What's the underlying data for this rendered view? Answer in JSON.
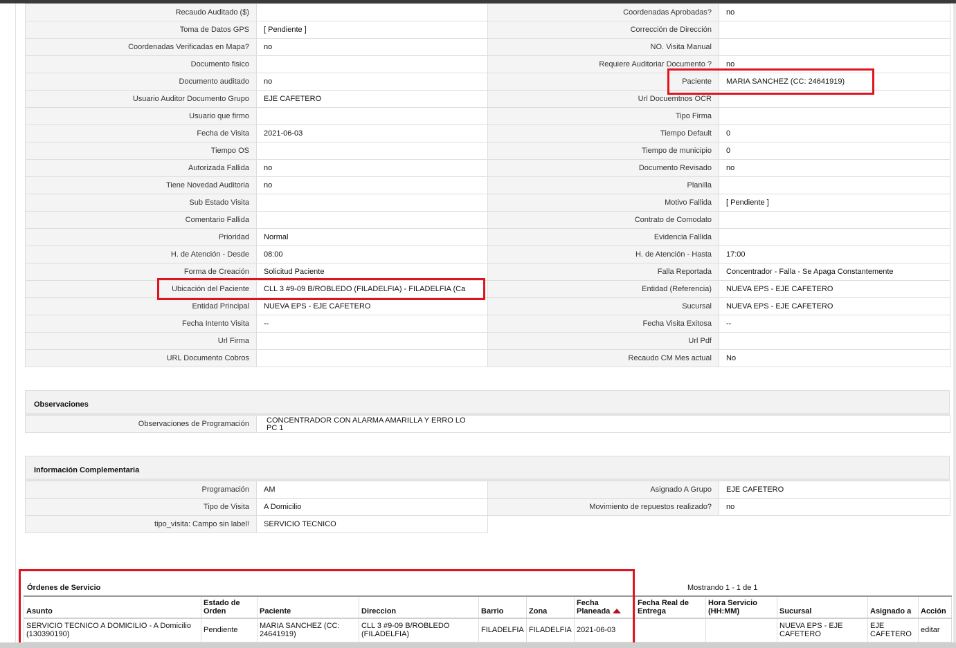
{
  "details": [
    {
      "l1": "Recaudo Auditado ($)",
      "v1": "",
      "l2": "Coordenadas Aprobadas?",
      "v2": "no"
    },
    {
      "l1": "Toma de Datos GPS",
      "v1": "[ Pendiente ]",
      "l2": "Corrección de Dirección",
      "v2": ""
    },
    {
      "l1": "Coordenadas Verificadas en Mapa?",
      "v1": "no",
      "l2": "NO. Visita Manual",
      "v2": ""
    },
    {
      "l1": "Documento fisico",
      "v1": "",
      "l2": "Requiere Auditoriar Documento ?",
      "v2": "no"
    },
    {
      "l1": "Documento auditado",
      "v1": "no",
      "l2": "Paciente",
      "v2": "MARIA SANCHEZ (CC: 24641919)"
    },
    {
      "l1": "Usuario Auditor Documento Grupo",
      "v1": "EJE CAFETERO",
      "l2": "Url Docuemtnos OCR",
      "v2": ""
    },
    {
      "l1": "Usuario que firmo",
      "v1": "",
      "l2": "Tipo Firma",
      "v2": ""
    },
    {
      "l1": "Fecha de Visita",
      "v1": "2021-06-03",
      "l2": "Tiempo Default",
      "v2": "0"
    },
    {
      "l1": "Tiempo OS",
      "v1": "",
      "l2": "Tiempo de municipio",
      "v2": "0"
    },
    {
      "l1": "Autorizada Fallida",
      "v1": "no",
      "l2": "Documento Revisado",
      "v2": "no"
    },
    {
      "l1": "Tiene Novedad Auditoria",
      "v1": "no",
      "l2": "Planilla",
      "v2": ""
    },
    {
      "l1": "Sub Estado Visita",
      "v1": "",
      "l2": "Motivo Fallida",
      "v2": "[ Pendiente ]"
    },
    {
      "l1": "Comentario Fallida",
      "v1": "",
      "l2": "Contrato de Comodato",
      "v2": ""
    },
    {
      "l1": "Prioridad",
      "v1": "Normal",
      "l2": "Evidencia Fallida",
      "v2": ""
    },
    {
      "l1": "H. de Atención - Desde",
      "v1": "08:00",
      "l2": "H. de Atención - Hasta",
      "v2": "17:00"
    },
    {
      "l1": "Forma de Creación",
      "v1": "Solicitud Paciente",
      "l2": "Falla Reportada",
      "v2": "Concentrador - Falla - Se Apaga Constantemente"
    },
    {
      "l1": "Ubicación del Paciente",
      "v1": "CLL 3 #9-09 B/ROBLEDO (FILADELFIA) - FILADELFIA (Ca",
      "l2": "Entidad (Referencia)",
      "v2": "NUEVA EPS - EJE CAFETERO"
    },
    {
      "l1": "Entidad Principal",
      "v1": "NUEVA EPS - EJE CAFETERO",
      "l2": "Sucursal",
      "v2": "NUEVA EPS - EJE CAFETERO"
    },
    {
      "l1": "Fecha Intento Visita",
      "v1": "--",
      "l2": "Fecha Visita Exitosa",
      "v2": "--"
    },
    {
      "l1": "Url Firma",
      "v1": "",
      "l2": "Url Pdf",
      "v2": ""
    },
    {
      "l1": "URL Documento Cobros",
      "v1": "",
      "l2": "Recaudo CM Mes actual",
      "v2": "No"
    }
  ],
  "observaciones": {
    "title": "Observaciones",
    "label": "Observaciones de Programación",
    "value": " CONCENTRADOR CON ALARMA AMARILLA Y ERRO LO PC 1"
  },
  "complementaria": {
    "title": "Información Complementaria",
    "rows": [
      {
        "l1": "Programación",
        "v1": "AM",
        "l2": "Asignado A Grupo",
        "v2": "EJE CAFETERO"
      },
      {
        "l1": "Tipo de Visita",
        "v1": "A Domicilio",
        "l2": "Movimiento de repuestos realizado?",
        "v2": "no"
      }
    ],
    "last": {
      "l1": "tipo_visita: Campo sin label!",
      "v1": "SERVICIO TECNICO"
    }
  },
  "orders": {
    "title": "Órdenes de Servicio",
    "count": "Mostrando 1 - 1 de 1",
    "headers": [
      "Asunto",
      "Estado de Orden",
      "Paciente",
      "Direccion",
      "Barrio",
      "Zona",
      "Fecha Planeada",
      "Fecha Real de Entrega",
      "Hora Servicio (HH:MM)",
      "Sucursal",
      "Asignado a",
      "Acción"
    ],
    "row": {
      "asunto": "SERVICIO TECNICO A DOMICILIO - A Domicilio (130390190)",
      "estado": "Pendiente",
      "paciente": "MARIA SANCHEZ (CC: 24641919)",
      "direccion": "CLL 3 #9-09 B/ROBLEDO (FILADELFIA)",
      "barrio": "FILADELFIA",
      "zona": "FILADELFIA",
      "fecha_planeada": "2021-06-03",
      "fecha_real": "",
      "hora": "",
      "sucursal": "NUEVA EPS - EJE CAFETERO",
      "asignado": "EJE CAFETERO",
      "accion": "editar"
    }
  },
  "colors": {
    "highlight": "#e0141e",
    "label_bg": "#f4f4f4",
    "border": "#dddddd"
  }
}
